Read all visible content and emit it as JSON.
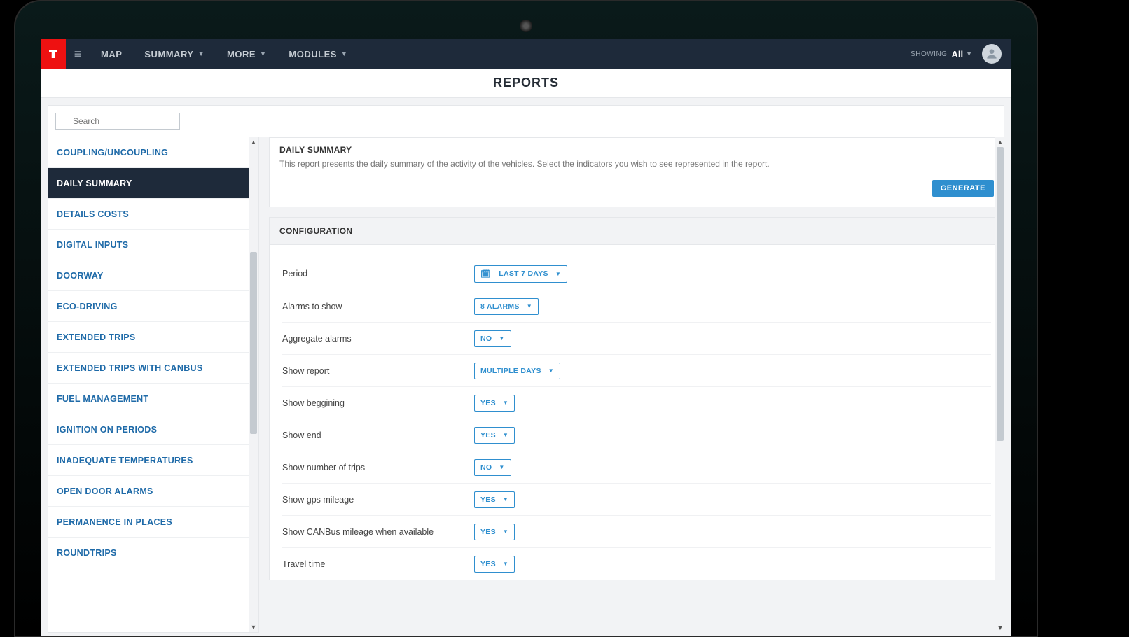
{
  "nav": {
    "map": "MAP",
    "summary": "SUMMARY",
    "more": "MORE",
    "modules": "MODULES",
    "showing": "SHOWING",
    "showing_val": "All"
  },
  "page_title": "REPORTS",
  "search": {
    "placeholder": "Search"
  },
  "sidebar": {
    "items": [
      "COUPLING/UNCOUPLING",
      "DAILY SUMMARY",
      "DETAILS COSTS",
      "DIGITAL INPUTS",
      "DOORWAY",
      "ECO-DRIVING",
      "EXTENDED TRIPS",
      "EXTENDED TRIPS WITH CANBUS",
      "FUEL MANAGEMENT",
      "IGNITION ON PERIODS",
      "INADEQUATE TEMPERATURES",
      "OPEN DOOR ALARMS",
      "PERMANENCE IN PLACES",
      "ROUNDTRIPS"
    ],
    "active_index": 1
  },
  "report": {
    "title": "DAILY SUMMARY",
    "description": "This report presents the daily summary of the activity of the vehicles. Select the indicators you wish to see represented in the report.",
    "generate": "GENERATE"
  },
  "configuration": {
    "title": "CONFIGURATION",
    "rows": [
      {
        "label": "Period",
        "value": "LAST 7 DAYS",
        "icon": "calendar"
      },
      {
        "label": "Alarms to show",
        "value": "8 ALARMS"
      },
      {
        "label": "Aggregate alarms",
        "value": "NO"
      },
      {
        "label": "Show report",
        "value": "MULTIPLE DAYS"
      },
      {
        "label": "Show beggining",
        "value": "YES"
      },
      {
        "label": "Show end",
        "value": "YES"
      },
      {
        "label": "Show number of trips",
        "value": "NO"
      },
      {
        "label": "Show gps mileage",
        "value": "YES"
      },
      {
        "label": "Show CANBus mileage when available",
        "value": "YES"
      },
      {
        "label": "Travel time",
        "value": "YES"
      }
    ]
  }
}
